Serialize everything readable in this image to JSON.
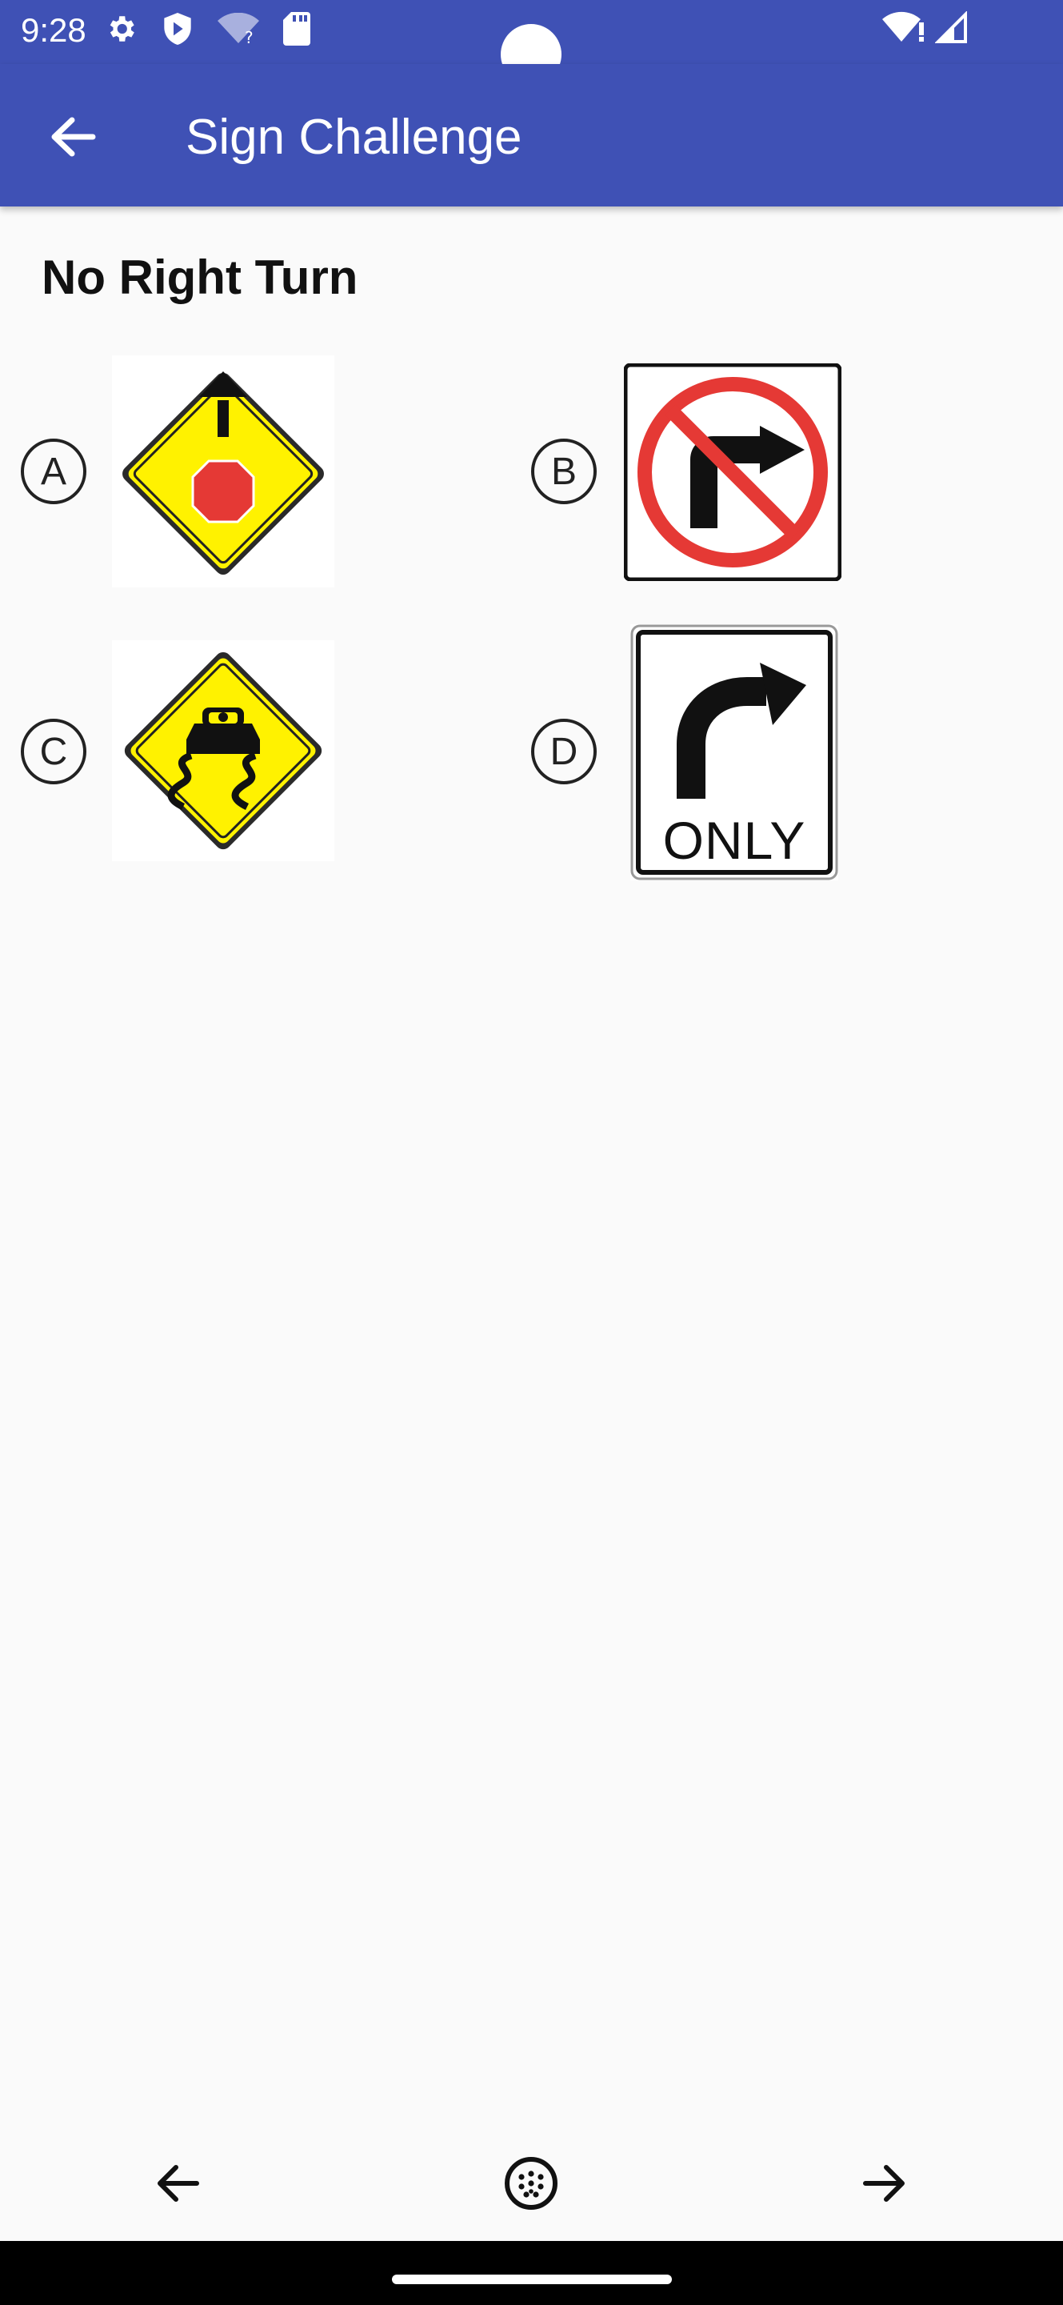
{
  "status_bar": {
    "time": "9:28",
    "icons": [
      "gear-icon",
      "shield-icon",
      "wifi-question-icon",
      "sd-card-icon",
      "wifi-alert-icon",
      "signal-icon"
    ]
  },
  "app_bar": {
    "title": "Sign Challenge",
    "back_icon": "arrow-left-icon"
  },
  "question": {
    "text": "No Right Turn"
  },
  "options": [
    {
      "letter": "A",
      "sign": "stop-ahead-sign"
    },
    {
      "letter": "B",
      "sign": "no-right-turn-sign"
    },
    {
      "letter": "C",
      "sign": "slippery-road-sign"
    },
    {
      "letter": "D",
      "sign": "right-turn-only-sign",
      "sign_text": "ONLY"
    }
  ],
  "bottom_nav": {
    "prev_icon": "arrow-left-icon",
    "center_icon": "grid-dots-icon",
    "next_icon": "arrow-right-icon"
  },
  "colors": {
    "primary": "#3f51b5",
    "background": "#fafafa",
    "warning_yellow": "#fff200",
    "sign_red": "#e53935"
  }
}
